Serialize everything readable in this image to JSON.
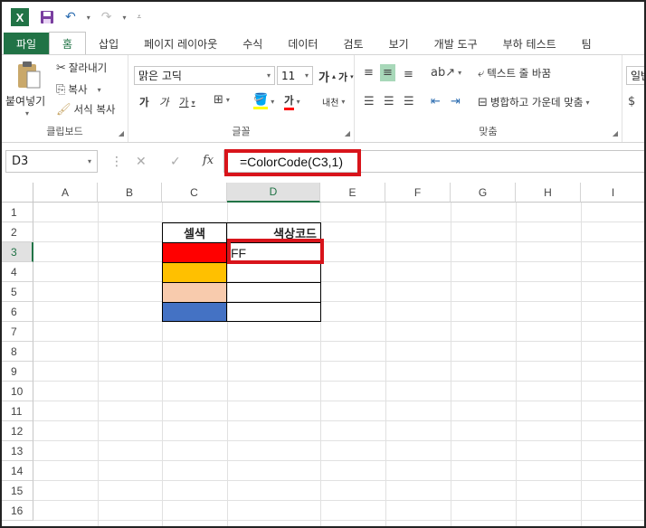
{
  "qat": {
    "app_logo": "X",
    "icons": [
      "save-icon",
      "undo-icon",
      "redo-icon",
      "customize-icon"
    ]
  },
  "tabs": [
    "파일",
    "홈",
    "삽입",
    "페이지 레이아웃",
    "수식",
    "데이터",
    "검토",
    "보기",
    "개발 도구",
    "부하 테스트",
    "팀"
  ],
  "ribbon": {
    "clipboard": {
      "paste": "붙여넣기",
      "cut": "잘라내기",
      "copy": "복사",
      "format_painter": "서식 복사",
      "label": "클립보드"
    },
    "font": {
      "name": "맑은 고딕",
      "size": "11",
      "label": "글꼴",
      "bold": "가",
      "italic": "가",
      "underline": "가",
      "grow": "가",
      "shrink": "가",
      "font_color": "가",
      "phonetic": "내천"
    },
    "alignment": {
      "wrap": "텍스트 줄 바꿈",
      "merge": "병합하고 가운데 맞춤",
      "label": "맞춤"
    },
    "number": {
      "format": "일반"
    }
  },
  "formula_bar": {
    "name_box": "D3",
    "formula": "=ColorCode(C3,1)",
    "fx": "fx"
  },
  "columns": [
    "A",
    "B",
    "C",
    "D",
    "E",
    "F",
    "G",
    "H",
    "I"
  ],
  "rows": [
    "1",
    "2",
    "3",
    "4",
    "5",
    "6",
    "7",
    "8",
    "9",
    "10",
    "11",
    "12",
    "13",
    "14",
    "15",
    "16"
  ],
  "sheet": {
    "c2": "셀색",
    "d2": "색상코드",
    "d3": "FF",
    "fill_colors": [
      "#ff0000",
      "#ffc000",
      "#f8cbad",
      "#4472c4"
    ]
  },
  "colors": {
    "accent": "#217346",
    "highlight": "#d8141b"
  }
}
